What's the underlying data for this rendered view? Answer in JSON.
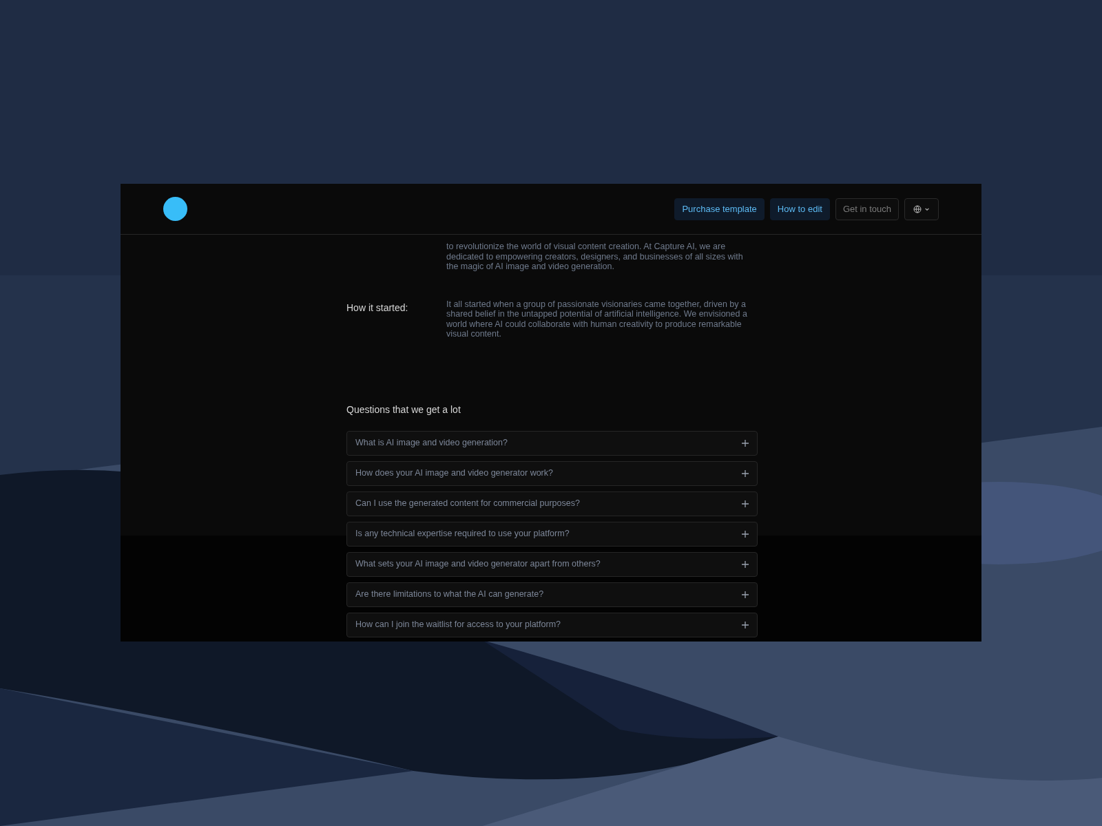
{
  "header": {
    "buttons": [
      {
        "label": "Purchase template",
        "kind": "primary"
      },
      {
        "label": "How to edit",
        "kind": "primary"
      },
      {
        "label": "Get in touch",
        "kind": "outline"
      }
    ]
  },
  "about": [
    {
      "text": "to revolutionize the world of visual content creation. At Capture AI, we are dedicated to empowering creators, designers, and businesses of all sizes with the magic of AI image and video generation."
    },
    {
      "label": "How it started:",
      "text": "It all started when a group of passionate visionaries came together, driven by a shared belief in the untapped potential of artificial intelligence. We envisioned a world where AI could collaborate with human creativity to produce remarkable visual content."
    }
  ],
  "faq": {
    "title": "Questions that we get a lot",
    "items": [
      {
        "question": "What is AI image and video generation?",
        "expanded": false
      },
      {
        "question": "How does your AI image and video generator work?",
        "expanded": false
      },
      {
        "question": "Can I use the generated content for commercial purposes?",
        "expanded": false
      },
      {
        "question": "Is any technical expertise required to use your platform?",
        "expanded": false
      },
      {
        "question": "What sets your AI image and video generator apart from others?",
        "expanded": false
      },
      {
        "question": "Are there limitations to what the AI can generate?",
        "expanded": false
      },
      {
        "question": "How can I join the waitlist for access to your platform?",
        "expanded": false
      }
    ]
  }
}
